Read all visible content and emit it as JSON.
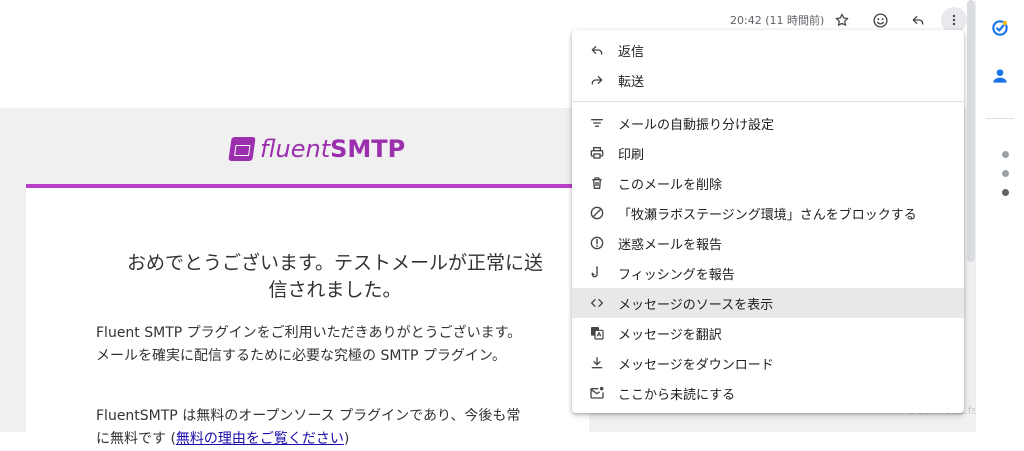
{
  "header": {
    "timestamp": "20:42 (11 時間前)",
    "icons": [
      "star-icon",
      "emoji-icon",
      "reply-icon",
      "more-vert-icon"
    ]
  },
  "email": {
    "logo": {
      "prefix": "fluent",
      "suffix": "SMTP"
    },
    "title": "おめでとうございます。テストメールが正常に送信されました。",
    "paragraph1": "Fluent SMTP プラグインをご利用いただきありがとうございます。メールを確実に配信するために必要な究極の SMTP プラグイン。",
    "paragraph2_text": "FluentSMTP は無料のオープンソース プラグインであり、今後も常に無料です (",
    "paragraph2_link": "無料の理由をご覧ください",
    "paragraph2_end": ")"
  },
  "menu": {
    "items": [
      {
        "label": "返信",
        "icon": "reply-icon"
      },
      {
        "label": "転送",
        "icon": "forward-icon"
      },
      {
        "label": "メールの自動振り分け設定",
        "icon": "filter-icon"
      },
      {
        "label": "印刷",
        "icon": "print-icon"
      },
      {
        "label": "このメールを削除",
        "icon": "trash-icon"
      },
      {
        "label": "「牧瀬ラボステージング環境」さんをブロックする",
        "icon": "block-icon"
      },
      {
        "label": "迷惑メールを報告",
        "icon": "spam-icon"
      },
      {
        "label": "フィッシングを報告",
        "icon": "phishing-icon"
      },
      {
        "label": "メッセージのソースを表示",
        "icon": "code-icon"
      },
      {
        "label": "メッセージを翻訳",
        "icon": "translate-icon"
      },
      {
        "label": "メッセージをダウンロード",
        "icon": "download-icon"
      },
      {
        "label": "ここから未読にする",
        "icon": "mark-unread-icon"
      }
    ]
  },
  "watermark": "©denneuz.fst.e"
}
